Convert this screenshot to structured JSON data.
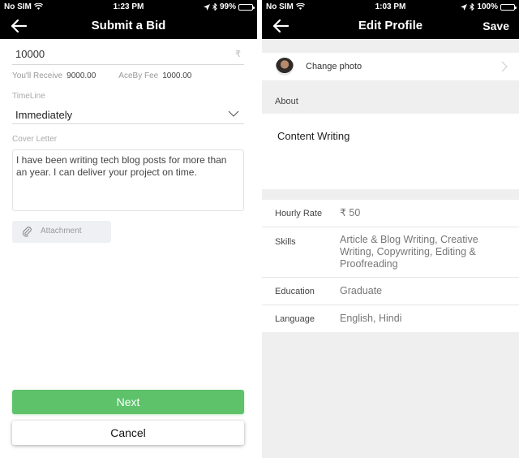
{
  "left_screen": {
    "status_bar": {
      "carrier": "No SIM",
      "time": "1:23 PM",
      "battery": "99%",
      "battery_level": 0.99
    },
    "nav": {
      "title": "Submit a Bid",
      "back_icon": "arrow-left-icon"
    },
    "amount": {
      "value": "10000",
      "currency_symbol": "₹"
    },
    "fees": {
      "receive_label": "You'll Receive",
      "receive_value": "9000.00",
      "fee_label": "AceBy Fee",
      "fee_value": "1000.00"
    },
    "timeline": {
      "label": "TimeLine",
      "selected": "Immediately"
    },
    "cover_letter": {
      "label": "Cover Letter",
      "value": "I have been writing tech blog posts for more than an year. I can deliver your project on time."
    },
    "attachment": {
      "label": "Attachment",
      "icon": "paperclip-icon"
    },
    "buttons": {
      "next": "Next",
      "cancel": "Cancel"
    },
    "colors": {
      "accent": "#5dc26a"
    }
  },
  "right_screen": {
    "status_bar": {
      "carrier": "No SIM",
      "time": "1:03 PM",
      "battery": "100%",
      "battery_level": 1.0
    },
    "nav": {
      "title": "Edit Profile",
      "save": "Save",
      "back_icon": "arrow-left-icon"
    },
    "photo": {
      "label": "Change photo"
    },
    "about": {
      "heading": "About",
      "value": "Content Writing"
    },
    "details": [
      {
        "key": "Hourly Rate",
        "value": "₹ 50"
      },
      {
        "key": "Skills",
        "value": "Article & Blog Writing, Creative Writing, Copywriting, Editing & Proofreading"
      },
      {
        "key": "Education",
        "value": "Graduate"
      },
      {
        "key": "Language",
        "value": "English, Hindi"
      }
    ]
  }
}
